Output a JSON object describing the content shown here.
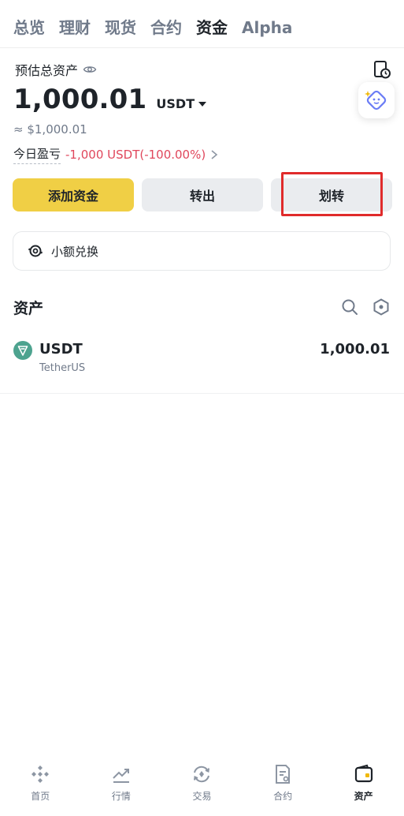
{
  "tabs": [
    {
      "label": "总览"
    },
    {
      "label": "理财"
    },
    {
      "label": "现货"
    },
    {
      "label": "合约"
    },
    {
      "label": "资金",
      "active": true
    },
    {
      "label": "Alpha"
    }
  ],
  "overview": {
    "estimated_label": "预估总资产",
    "balance": "1,000.01",
    "unit": "USDT",
    "fiat": "≈ $1,000.01",
    "pnl_label": "今日盈亏",
    "pnl_value": "-1,000 USDT(-100.00%)",
    "pnl_arrow": ">"
  },
  "actions": {
    "add": "添加资金",
    "withdraw": "转出",
    "transfer": "划转"
  },
  "swap": {
    "label": "小额兑换"
  },
  "assets": {
    "title": "资产",
    "items": [
      {
        "symbol": "USDT",
        "name": "TetherUS",
        "amount": "1,000.01"
      }
    ]
  },
  "bottom_nav": [
    {
      "label": "首页",
      "icon": "home-icon"
    },
    {
      "label": "行情",
      "icon": "markets-icon"
    },
    {
      "label": "交易",
      "icon": "trade-icon"
    },
    {
      "label": "合约",
      "icon": "futures-icon"
    },
    {
      "label": "资产",
      "icon": "wallet-icon",
      "active": true
    }
  ],
  "colors": {
    "accent": "#f0cf45",
    "loss": "#e0475c",
    "highlight": "#e02b2b",
    "tether": "#4da38f"
  }
}
